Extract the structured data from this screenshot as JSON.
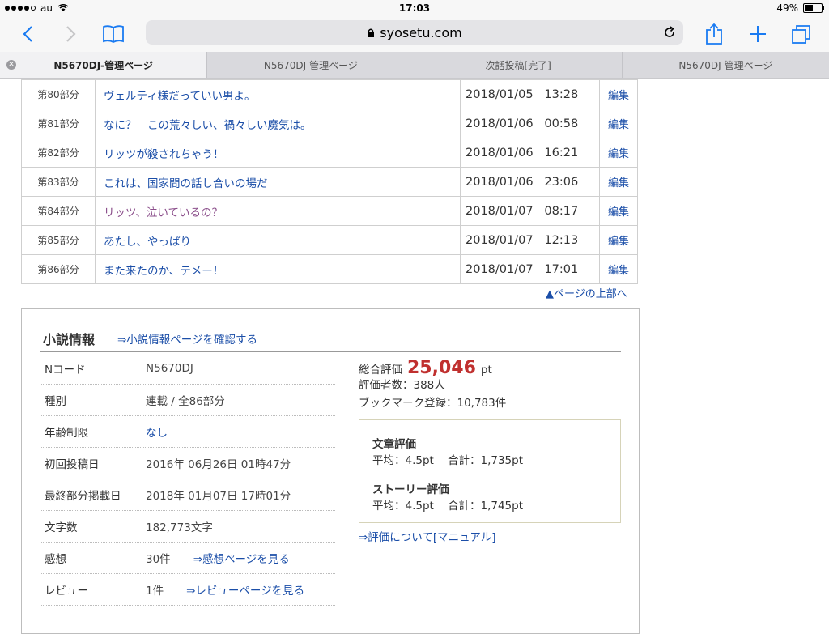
{
  "status": {
    "carrier": "au",
    "time": "17:03",
    "battery": "49%",
    "battery_level": 0.49
  },
  "browser": {
    "url": "syosetu.com",
    "tabs": [
      {
        "label": "N5670DJ-管理ページ",
        "active": true
      },
      {
        "label": "N5670DJ-管理ページ",
        "active": false
      },
      {
        "label": "次話投稿[完了]",
        "active": false
      },
      {
        "label": "N5670DJ-管理ページ",
        "active": false
      }
    ]
  },
  "chapters": {
    "edit_label": "編集",
    "rows": [
      {
        "num": "第80部分",
        "title": "ヴェルティ様だっていい男よ。",
        "date": "2018/01/05   13:28",
        "visited": false
      },
      {
        "num": "第81部分",
        "title": "なに？　この荒々しい、禍々しい魔気は。",
        "date": "2018/01/06   00:58",
        "visited": false
      },
      {
        "num": "第82部分",
        "title": "リッツが殺されちゃう！",
        "date": "2018/01/06   16:21",
        "visited": false
      },
      {
        "num": "第83部分",
        "title": "これは、国家間の話し合いの場だ",
        "date": "2018/01/06   23:06",
        "visited": false
      },
      {
        "num": "第84部分",
        "title": "リッツ、泣いているの？",
        "date": "2018/01/07   08:17",
        "visited": true
      },
      {
        "num": "第85部分",
        "title": "あたし、やっぱり",
        "date": "2018/01/07   12:13",
        "visited": false
      },
      {
        "num": "第86部分",
        "title": "また来たのか、テメー！",
        "date": "2018/01/07   17:01",
        "visited": false
      }
    ]
  },
  "page_top_link": "▲ページの上部へ",
  "info": {
    "heading": "小説情報",
    "link": "⇒小説情報ページを確認する",
    "rows": [
      {
        "key": "Nコード",
        "value": "N5670DJ"
      },
      {
        "key": "種別",
        "value": "連載 / 全86部分"
      },
      {
        "key": "年齢制限",
        "value": "なし"
      },
      {
        "key": "初回投稿日",
        "value": "2016年 06月26日 01時47分"
      },
      {
        "key": "最終部分掲載日",
        "value": "2018年 01月07日 17時01分"
      },
      {
        "key": "文字数",
        "value": "182,773文字"
      },
      {
        "key": "感想",
        "value": "30件",
        "link": "⇒感想ページを見る"
      },
      {
        "key": "レビュー",
        "value": "1件",
        "link": "⇒レビューページを見る"
      }
    ],
    "total_label": "総合評価",
    "total_value": "25,046",
    "total_unit": "pt",
    "raters": "評価者数：388人",
    "bookmarks": "ブックマーク登録：10,783件",
    "ratings": {
      "writing_title": "文章評価",
      "writing_detail": "平均：4.5pt    合計：1,735pt",
      "story_title": "ストーリー評価",
      "story_detail": "平均：4.5pt    合計：1,745pt"
    },
    "manual_link": "⇒評価について[マニュアル]"
  },
  "colors": {
    "link": "#1b4ea8",
    "visited": "#8a4d8a",
    "points": "#c0302f",
    "accent": "#1a7bf2"
  }
}
